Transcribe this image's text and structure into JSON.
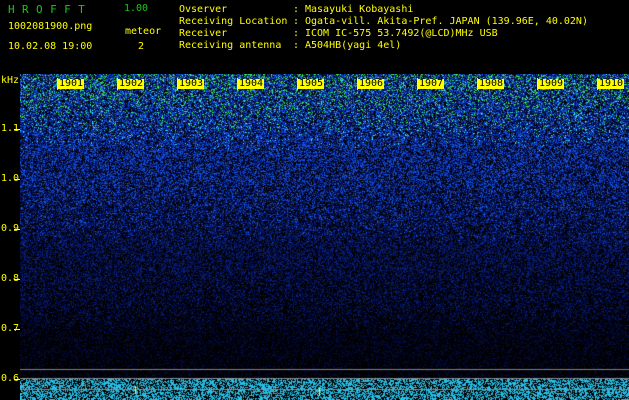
{
  "header": {
    "app_title": "HROFFT",
    "app_version": "1.00",
    "filename": "1002081900.png",
    "datetime": "10.02.08 19:00",
    "meteor_label": "meteor",
    "meteor_count": "2"
  },
  "station_info": [
    {
      "label": "Ovserver",
      "value": "Masayuki Kobayashi"
    },
    {
      "label": "Receiving Location",
      "value": "Ogata-vill. Akita-Pref. JAPAN (139.96E, 40.02N)"
    },
    {
      "label": "Receiver",
      "value": "ICOM IC-575 53.7492(@LCD)MHz USB"
    },
    {
      "label": "Receiving antenna",
      "value": "A504HB(yagi 4el)"
    }
  ],
  "info_separator": ":",
  "axes": {
    "y_unit": "kHz",
    "y_ticks": [
      "1.1",
      "1.0",
      "0.9",
      "0.8",
      "0.7",
      "0.6"
    ],
    "x_ticks": [
      "1901",
      "1902",
      "1903",
      "1904",
      "1905",
      "1906",
      "1907",
      "1908",
      "1909",
      "1910"
    ]
  },
  "colors": {
    "background": "#000000",
    "title_green": "#18c818",
    "text_yellow": "#ffff00",
    "band_blue_dark": "#0a1e6a",
    "band_blue": "#1e50dc",
    "band_cyan": "#3ce6ff",
    "band_green": "#30dc46"
  }
}
